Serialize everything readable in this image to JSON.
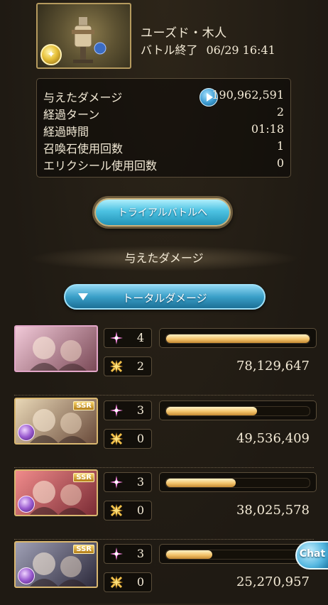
{
  "header": {
    "boss_name": "ユーズド・木人",
    "battle_end_label": "バトル終了",
    "battle_end_date": "06/29 16:41"
  },
  "stats": [
    {
      "label": "与えたダメージ",
      "value": "190,962,591",
      "icon": "play-icon"
    },
    {
      "label": "経過ターン",
      "value": "2"
    },
    {
      "label": "経過時間",
      "value": "01:18"
    },
    {
      "label": "召喚石使用回数",
      "value": "1"
    },
    {
      "label": "エリクシール使用回数",
      "value": "0"
    }
  ],
  "trial_button": {
    "label": "トライアルバトルへ"
  },
  "damage_section": {
    "heading": "与えたダメージ"
  },
  "dropdown": {
    "label": "トータルダメージ"
  },
  "characters": [
    {
      "skill_count": "4",
      "ca_count": "2",
      "damage": "78,129,647",
      "ratio": 1.0,
      "ssr": "",
      "colors": [
        "#f1c9d8",
        "#7b4a57"
      ]
    },
    {
      "skill_count": "3",
      "ca_count": "0",
      "damage": "49,536,409",
      "ratio": 0.634,
      "ssr": "SSR",
      "colors": [
        "#e8d7b6",
        "#6a4b3b"
      ]
    },
    {
      "skill_count": "3",
      "ca_count": "0",
      "damage": "38,025,578",
      "ratio": 0.487,
      "ssr": "SSR",
      "colors": [
        "#f08b8b",
        "#7b2c35"
      ]
    },
    {
      "skill_count": "3",
      "ca_count": "0",
      "damage": "25,270,957",
      "ratio": 0.323,
      "ssr": "SSR",
      "colors": [
        "#9fa0b5",
        "#2d2a3c"
      ]
    }
  ],
  "chat": {
    "label": "Chat"
  },
  "colors": {
    "accent_blue": "#3a9fc8",
    "bar_gold": "#f3c36b",
    "text": "#f3ead6"
  }
}
